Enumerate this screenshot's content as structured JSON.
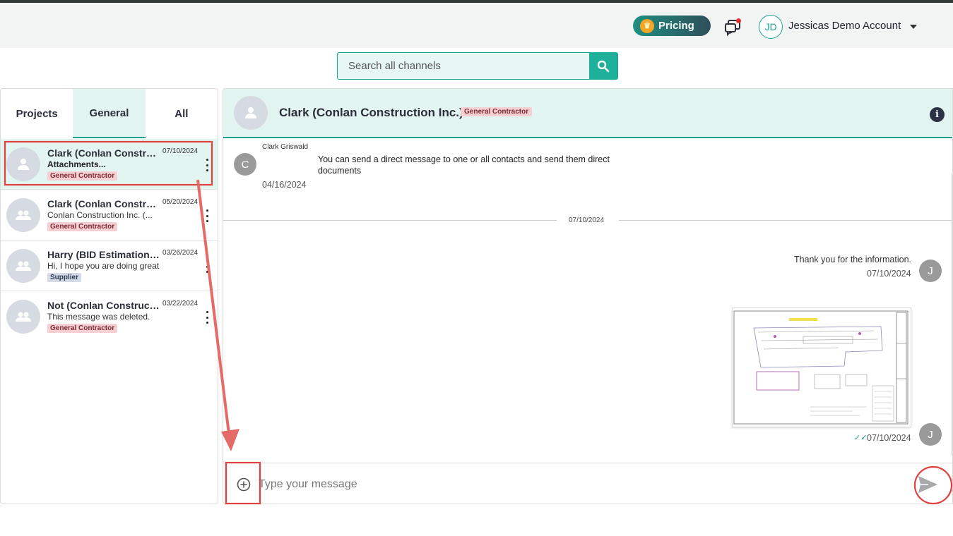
{
  "header": {
    "pricing_label": "Pricing",
    "account_initials": "JD",
    "account_name": "Jessicas Demo Account"
  },
  "search": {
    "placeholder": "Search all channels"
  },
  "tabs": [
    {
      "label": "Projects"
    },
    {
      "label": "General"
    },
    {
      "label": "All"
    }
  ],
  "conversations": [
    {
      "title": "Clark (Conlan Construction Inc.)",
      "date": "07/10/2024",
      "preview": "Attachments...",
      "tag": "General Contractor",
      "icon": "person-icon"
    },
    {
      "title": "Clark (Conlan Construction Inc.)",
      "date": "05/20/2024",
      "preview": "Conlan Construction Inc. (...",
      "tag": "General Contractor",
      "icon": "group-icon"
    },
    {
      "title": "Harry (BID Estimation, LLC)",
      "date": "03/26/2024",
      "preview": "Hi, I hope you are doing great",
      "tag": "Supplier",
      "icon": "group-icon"
    },
    {
      "title": "Not (Conlan Construction Inc.)",
      "date": "03/22/2024",
      "preview": "This message was deleted.",
      "tag": "General Contractor",
      "icon": "group-icon"
    }
  ],
  "chat": {
    "title": "Clark (Conlan Construction Inc.)",
    "tag": "General Contractor",
    "messages": {
      "incoming": {
        "avatar": "C",
        "sender": "Clark Griswald",
        "text": "You can send a direct message to one or all contacts and send them direct documents",
        "time": "04/16/2024"
      },
      "divider_date": "07/10/2024",
      "outgoing_text": {
        "avatar": "J",
        "text": "Thank you for the information.",
        "time": "07/10/2024"
      },
      "outgoing_attachment": {
        "avatar": "J",
        "time": "07/10/2024"
      }
    }
  },
  "composer": {
    "placeholder": "Type your message"
  },
  "colors": {
    "accent": "#1aa38f",
    "active_bg": "#e2f5f1",
    "annotation": "#e0403f"
  }
}
